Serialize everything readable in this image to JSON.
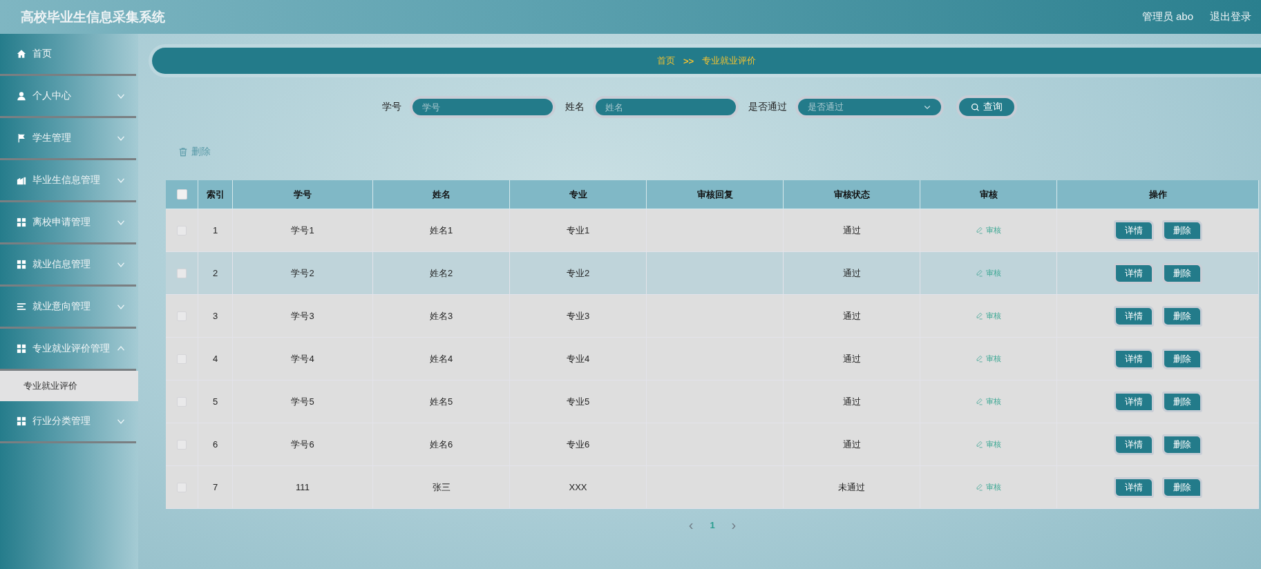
{
  "header": {
    "title": "高校毕业生信息采集系统",
    "user": "管理员 abo",
    "logout": "退出登录"
  },
  "sidebar": {
    "items": [
      {
        "label": "首页",
        "kind": "link"
      },
      {
        "label": "个人中心",
        "kind": "menu",
        "expanded": false
      },
      {
        "label": "学生管理",
        "kind": "menu",
        "expanded": false
      },
      {
        "label": "毕业生信息管理",
        "kind": "menu",
        "expanded": false
      },
      {
        "label": "离校申请管理",
        "kind": "menu",
        "expanded": false
      },
      {
        "label": "就业信息管理",
        "kind": "menu",
        "expanded": false
      },
      {
        "label": "就业意向管理",
        "kind": "menu",
        "expanded": false
      },
      {
        "label": "专业就业评价管理",
        "kind": "menu",
        "expanded": true,
        "children": [
          {
            "label": "专业就业评价",
            "selected": true
          }
        ]
      },
      {
        "label": "行业分类管理",
        "kind": "menu",
        "expanded": false
      }
    ]
  },
  "breadcrumb": {
    "home": "首页",
    "separator": ">>",
    "current": "专业就业评价"
  },
  "search": {
    "fields": [
      {
        "label": "学号",
        "kind": "input",
        "placeholder": "学号"
      },
      {
        "label": "姓名",
        "kind": "input",
        "placeholder": "姓名"
      },
      {
        "label": "是否通过",
        "kind": "select",
        "placeholder": "是否通过"
      }
    ],
    "button": "查询"
  },
  "delete_button": "删除",
  "table": {
    "select_all_checked": false,
    "columns": [
      "索引",
      "学号",
      "姓名",
      "专业",
      "审核回复",
      "审核状态",
      "审核",
      "操作"
    ],
    "rows": [
      {
        "checked": false,
        "hovered": false,
        "index": "1",
        "student_no": "学号1",
        "name": "姓名1",
        "major": "专业1",
        "reply": "",
        "status": "通过",
        "review": "审核",
        "actions": [
          "详情",
          "删除"
        ]
      },
      {
        "checked": false,
        "hovered": true,
        "index": "2",
        "student_no": "学号2",
        "name": "姓名2",
        "major": "专业2",
        "reply": "",
        "status": "通过",
        "review": "审核",
        "actions": [
          "详情",
          "删除"
        ]
      },
      {
        "checked": false,
        "hovered": false,
        "index": "3",
        "student_no": "学号3",
        "name": "姓名3",
        "major": "专业3",
        "reply": "",
        "status": "通过",
        "review": "审核",
        "actions": [
          "详情",
          "删除"
        ]
      },
      {
        "checked": false,
        "hovered": false,
        "index": "4",
        "student_no": "学号4",
        "name": "姓名4",
        "major": "专业4",
        "reply": "",
        "status": "通过",
        "review": "审核",
        "actions": [
          "详情",
          "删除"
        ]
      },
      {
        "checked": false,
        "hovered": false,
        "index": "5",
        "student_no": "学号5",
        "name": "姓名5",
        "major": "专业5",
        "reply": "",
        "status": "通过",
        "review": "审核",
        "actions": [
          "详情",
          "删除"
        ]
      },
      {
        "checked": false,
        "hovered": false,
        "index": "6",
        "student_no": "学号6",
        "name": "姓名6",
        "major": "专业6",
        "reply": "",
        "status": "通过",
        "review": "审核",
        "actions": [
          "详情",
          "删除"
        ]
      },
      {
        "checked": false,
        "hovered": false,
        "index": "7",
        "student_no": "111",
        "name": "张三",
        "major": "XXX",
        "reply": "",
        "status": "未通过",
        "review": "审核",
        "actions": [
          "详情",
          "删除"
        ]
      }
    ]
  },
  "pagination": {
    "prev": "‹",
    "pages": [
      {
        "label": "1",
        "selected": true
      }
    ],
    "next": "›"
  }
}
